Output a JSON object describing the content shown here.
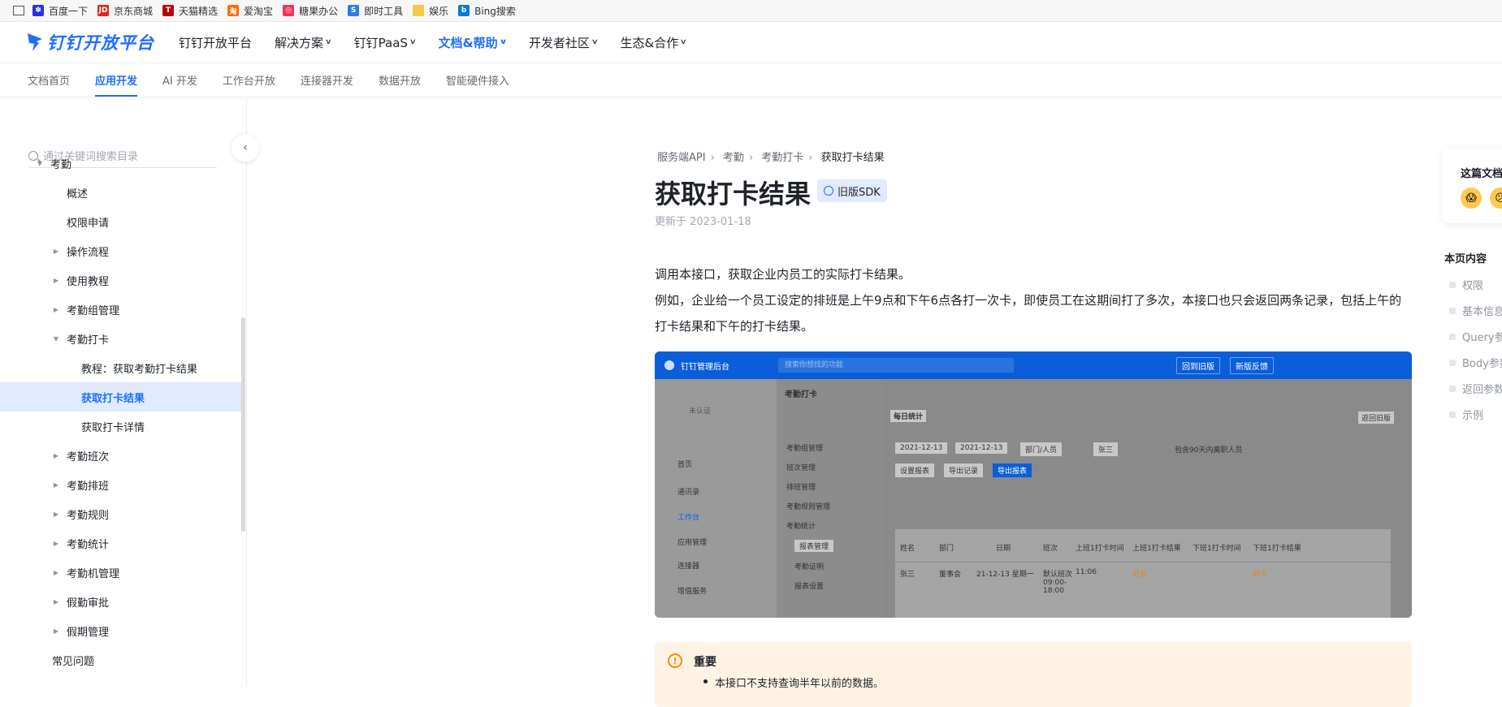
{
  "bookmarks": [
    {
      "label": "百度一下",
      "icon": "baidu-icon",
      "color": "#2932e1",
      "glyph": "✽"
    },
    {
      "label": "京东商城",
      "icon": "jd-icon",
      "color": "#e1251b",
      "glyph": "JD"
    },
    {
      "label": "天猫精选",
      "icon": "tmall-icon",
      "color": "#b8000a",
      "glyph": "T"
    },
    {
      "label": "爱淘宝",
      "icon": "taobao-icon",
      "color": "#ff6a00",
      "glyph": "淘"
    },
    {
      "label": "糖果办公",
      "icon": "candy-office-icon",
      "color": "#ff2d55",
      "glyph": "◎"
    },
    {
      "label": "即时工具",
      "icon": "tools-icon",
      "color": "#2b7de9",
      "glyph": "S"
    },
    {
      "label": "娱乐",
      "icon": "folder-icon",
      "color": "#f2c94c",
      "glyph": ""
    },
    {
      "label": "Bing搜索",
      "icon": "bing-icon",
      "color": "#0a7ad1",
      "glyph": "b"
    }
  ],
  "header": {
    "logo_text": "钉钉开放平台",
    "nav": [
      {
        "label": "钉钉开放平台",
        "chevron": false,
        "active": false
      },
      {
        "label": "解决方案",
        "chevron": true,
        "active": false
      },
      {
        "label": "钉钉PaaS",
        "chevron": true,
        "active": false
      },
      {
        "label": "文档&帮助",
        "chevron": true,
        "active": true
      },
      {
        "label": "开发者社区",
        "chevron": true,
        "active": false
      },
      {
        "label": "生态&合作",
        "chevron": true,
        "active": false
      }
    ]
  },
  "subnav": [
    {
      "label": "文档首页",
      "active": false
    },
    {
      "label": "应用开发",
      "active": true
    },
    {
      "label": "AI 开发",
      "active": false
    },
    {
      "label": "工作台开放",
      "active": false
    },
    {
      "label": "连接器开发",
      "active": false
    },
    {
      "label": "数据开放",
      "active": false
    },
    {
      "label": "智能硬件接入",
      "active": false
    }
  ],
  "sidebar": {
    "search_placeholder": "通过关键词搜索目录",
    "items": [
      {
        "label": "考勤",
        "level": 0,
        "arrow": "down"
      },
      {
        "label": "概述",
        "level": 2,
        "arrow": ""
      },
      {
        "label": "权限申请",
        "level": 2,
        "arrow": ""
      },
      {
        "label": "操作流程",
        "level": 1,
        "arrow": "right"
      },
      {
        "label": "使用教程",
        "level": 1,
        "arrow": "right"
      },
      {
        "label": "考勤组管理",
        "level": 1,
        "arrow": "right"
      },
      {
        "label": "考勤打卡",
        "level": 1,
        "arrow": "down"
      },
      {
        "label": "教程：获取考勤打卡结果",
        "level": 3,
        "arrow": ""
      },
      {
        "label": "获取打卡结果",
        "level": 3,
        "arrow": "",
        "selected": true
      },
      {
        "label": "获取打卡详情",
        "level": 3,
        "arrow": ""
      },
      {
        "label": "考勤班次",
        "level": 1,
        "arrow": "right"
      },
      {
        "label": "考勤排班",
        "level": 1,
        "arrow": "right"
      },
      {
        "label": "考勤规则",
        "level": 1,
        "arrow": "right"
      },
      {
        "label": "考勤统计",
        "level": 1,
        "arrow": "right"
      },
      {
        "label": "考勤机管理",
        "level": 1,
        "arrow": "right"
      },
      {
        "label": "假勤审批",
        "level": 1,
        "arrow": "right"
      },
      {
        "label": "假期管理",
        "level": 1,
        "arrow": "right"
      },
      {
        "label": "常见问题",
        "level": 1,
        "arrow": ""
      }
    ]
  },
  "article": {
    "breadcrumb": [
      "服务端API",
      "考勤",
      "考勤打卡",
      "获取打卡结果"
    ],
    "title": "获取打卡结果",
    "badge": "旧版SDK",
    "updated": "更新于 2023-01-18",
    "para1": "调用本接口，获取企业内员工的实际打卡结果。",
    "para2": "例如，企业给一个员工设定的排班是上午9点和下午6点各打一次卡，即使员工在这期间打了多次，本接口也只会返回两条记录，包括上午的打卡结果和下午的打卡结果。",
    "notice_title": "重要",
    "notice_item": "本接口不支持查询半年以前的数据。"
  },
  "screenshot": {
    "app_title": "钉钉管理后台",
    "search": "搜索你想找的功能",
    "btn_old": "回到旧版",
    "btn_feedback": "新版反馈",
    "org_status": "未认证",
    "page_title": "考勤打卡",
    "sub_title": "每日统计",
    "back": "返回旧版",
    "left_menu": [
      "首页",
      "通讯录",
      "工作台",
      "应用管理",
      "连接器",
      "增值服务"
    ],
    "mid_menu": [
      "考勤组管理",
      "班次管理",
      "排班管理",
      "考勤规则管理",
      "考勤统计",
      "报表管理",
      "考勤证明",
      "报表设置"
    ],
    "date_from": "2021-12-13",
    "date_to": "2021-12-13",
    "dept": "部门/人员",
    "person": "张三",
    "checkbox": "包含90天内离职人员",
    "buttons": [
      "设置报表",
      "导出记录",
      "导出报表"
    ],
    "cols": [
      "姓名",
      "部门",
      "日期",
      "班次",
      "上班1打卡时间",
      "上班1打卡结果",
      "下班1打卡时间",
      "下班1打卡结果"
    ],
    "row": [
      "张三",
      "董事会",
      "21-12-13 星期一",
      "默认班次 09:00-18:00",
      "11:06",
      "迟到",
      "",
      "缺卡"
    ]
  },
  "feedback": {
    "title": "这篇文档"
  },
  "toc": {
    "title": "本页内容",
    "items": [
      "权限",
      "基本信息",
      "Query参数",
      "Body参数",
      "返回参数",
      "示例"
    ]
  }
}
